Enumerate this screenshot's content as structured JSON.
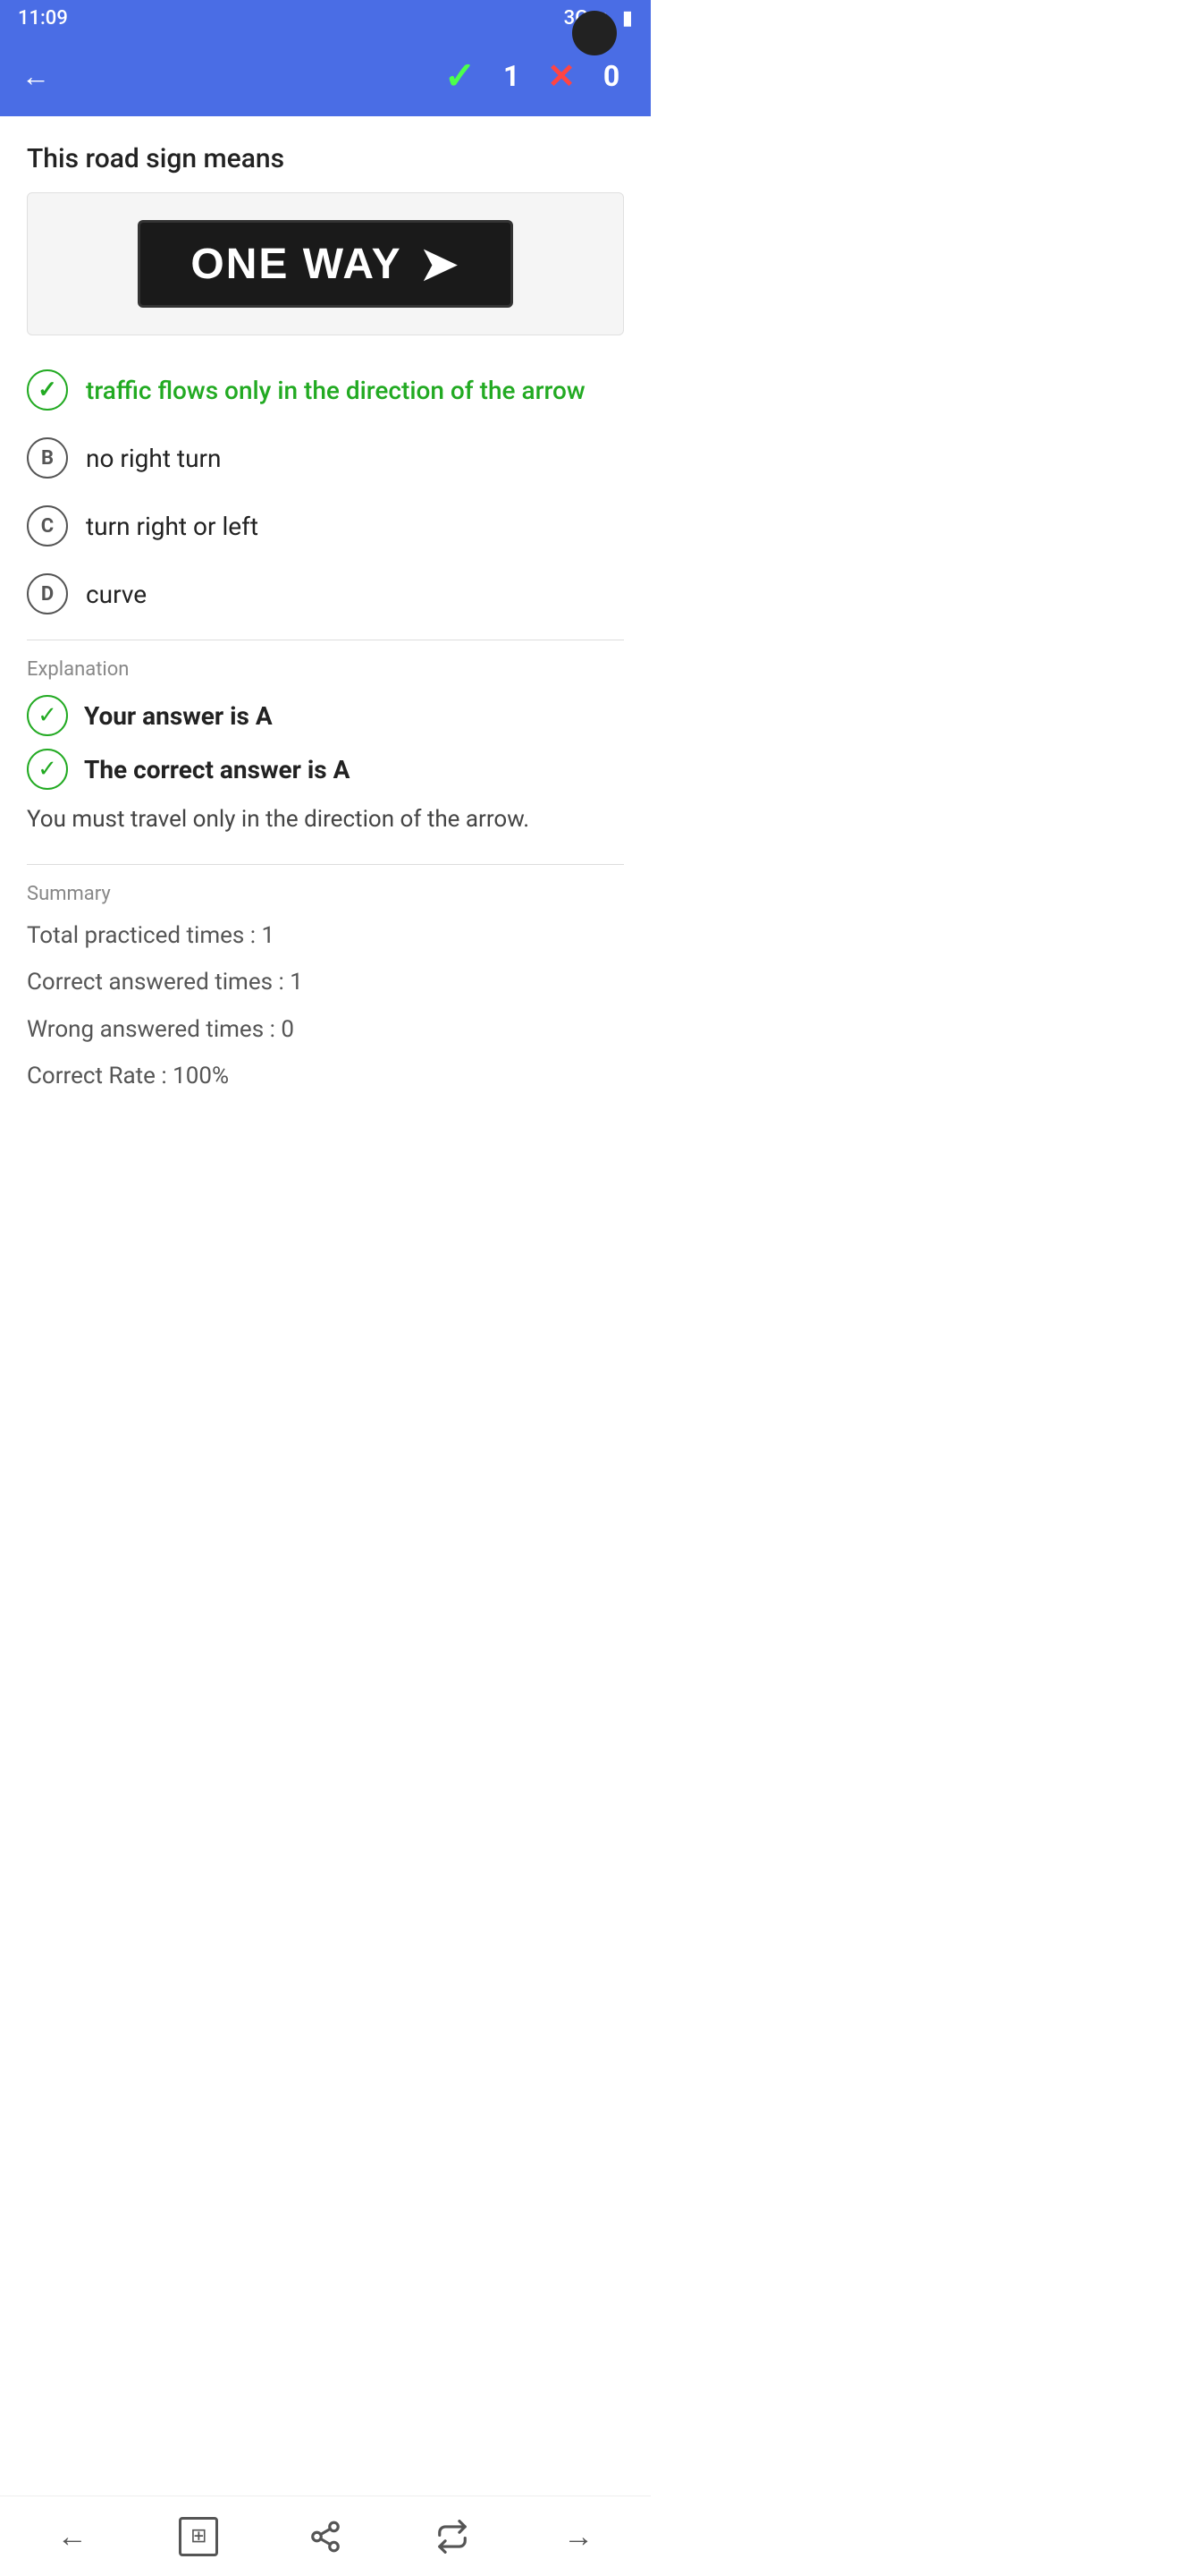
{
  "statusBar": {
    "time": "11:09",
    "networkType": "3G",
    "icons": [
      "settings",
      "vpn",
      "battery"
    ]
  },
  "navBar": {
    "backLabel": "←",
    "checkIcon": "✓",
    "correctCount": "1",
    "xIcon": "✕",
    "wrongCount": "0"
  },
  "question": {
    "title": "This road sign means",
    "signAlt": "ONE WAY sign with right arrow"
  },
  "options": [
    {
      "id": "A",
      "text": "traffic flows only in the direction of the arrow",
      "state": "correct"
    },
    {
      "id": "B",
      "text": "no right turn",
      "state": "normal"
    },
    {
      "id": "C",
      "text": "turn right or left",
      "state": "normal"
    },
    {
      "id": "D",
      "text": "curve",
      "state": "normal"
    }
  ],
  "explanation": {
    "sectionLabel": "Explanation",
    "yourAnswer": "Your answer is A",
    "correctAnswer": "The correct answer is A",
    "body": "You must travel only in the direction of the arrow."
  },
  "summary": {
    "sectionLabel": "Summary",
    "totalPracticed": "Total practiced times : 1",
    "correctAnswered": "Correct answered times : 1",
    "wrongAnswered": "Wrong answered times : 0",
    "correctRate": "Correct Rate : 100%"
  },
  "bottomNav": {
    "backIcon": "←",
    "homeIcon": "⊞",
    "shareIcon": "share",
    "repeatIcon": "↺",
    "nextIcon": "→"
  }
}
